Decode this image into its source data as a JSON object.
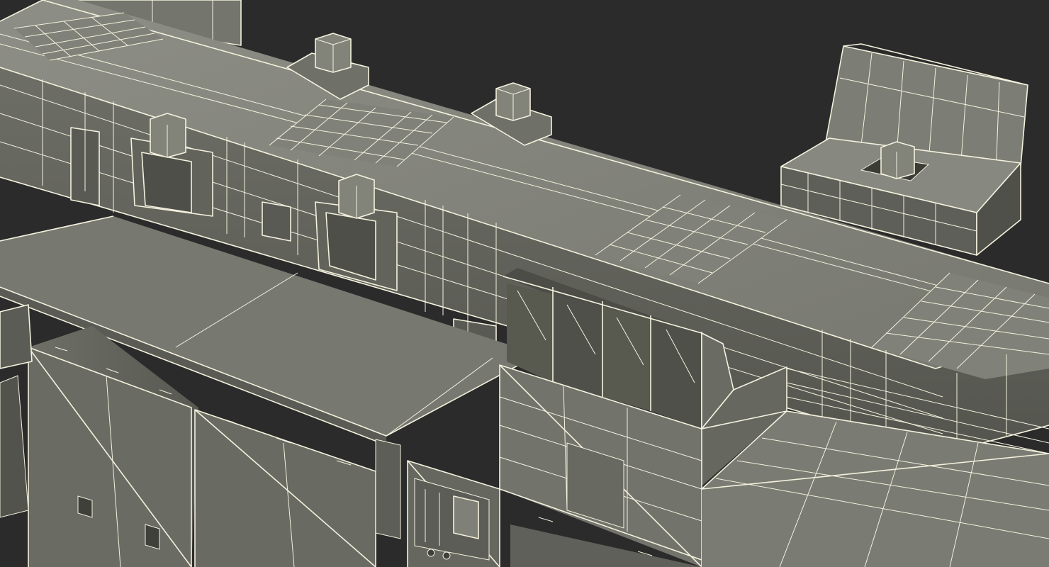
{
  "scene": {
    "kind": "3D wireframe render of a modular mechanical assembly",
    "colors": {
      "background": "#2b2b2b",
      "surface_light": "#8a8b82",
      "surface_mid": "#75766e",
      "surface_dark": "#5b5c55",
      "surface_shadow": "#45463f",
      "wire": "#f4f1de"
    }
  }
}
